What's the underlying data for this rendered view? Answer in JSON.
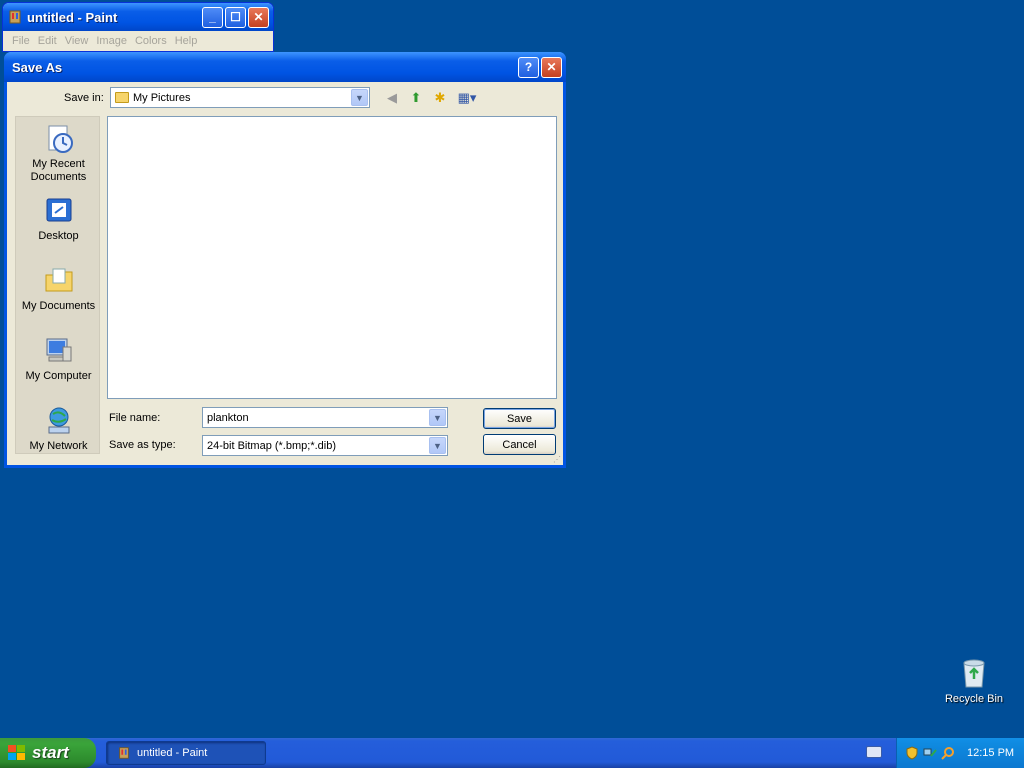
{
  "paint_window": {
    "title": "untitled - Paint",
    "menu": [
      "File",
      "Edit",
      "View",
      "Image",
      "Colors",
      "Help"
    ]
  },
  "dialog": {
    "title": "Save As",
    "save_in_label": "Save in:",
    "save_in_value": "My Pictures",
    "places": [
      {
        "label_line1": "My Recent",
        "label_line2": "Documents",
        "icon": "recent-documents-icon"
      },
      {
        "label_line1": "Desktop",
        "label_line2": "",
        "icon": "desktop-icon"
      },
      {
        "label_line1": "My Documents",
        "label_line2": "",
        "icon": "my-documents-icon"
      },
      {
        "label_line1": "My Computer",
        "label_line2": "",
        "icon": "my-computer-icon"
      },
      {
        "label_line1": "My Network",
        "label_line2": "",
        "icon": "my-network-icon"
      }
    ],
    "file_name_label": "File name:",
    "file_name_value": "plankton",
    "save_as_type_label": "Save as type:",
    "save_as_type_value": "24-bit Bitmap (*.bmp;*.dib)",
    "save_button": "Save",
    "cancel_button": "Cancel"
  },
  "desktop": {
    "recycle_bin_label": "Recycle Bin"
  },
  "taskbar": {
    "start_label": "start",
    "task_button_label": "untitled - Paint",
    "clock": "12:15 PM"
  },
  "colors": {
    "desktop": "#004e98",
    "titlebar": "#0054e3",
    "start": "#3c9a3c",
    "taskbar": "#245edb",
    "tray": "#0f8ae0"
  }
}
